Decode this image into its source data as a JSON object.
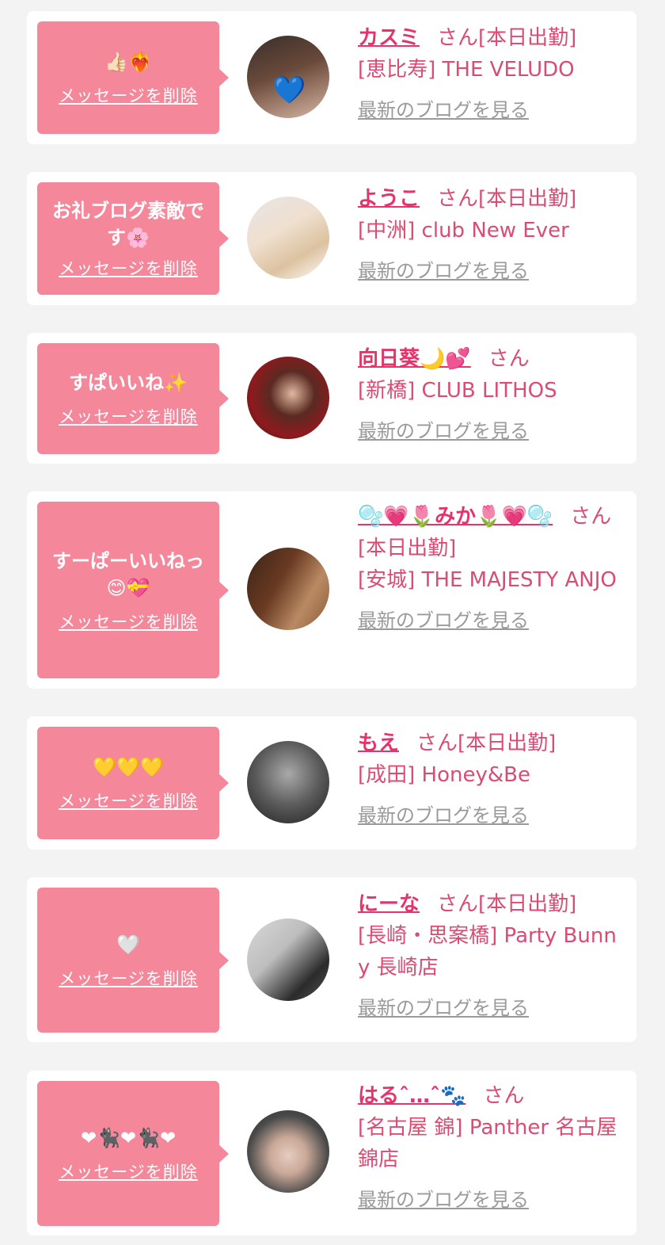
{
  "cards": [
    {
      "message": "👍🏻❤️‍🔥",
      "delete_label": "メッセージを削除",
      "name": "カスミ",
      "honorific": "さん",
      "status": "[本日出勤]",
      "shop": "[恵比寿] THE VELUDO",
      "blog_label": "最新のブログを見る",
      "avatar_colors": [
        "#3a2e2a",
        "#d9b6a6"
      ]
    },
    {
      "message": "お礼ブログ素敵です🌸",
      "delete_label": "メッセージを削除",
      "name": "ようこ",
      "honorific": "さん",
      "status": "[本日出勤]",
      "shop": "[中洲] club New Ever",
      "blog_label": "最新のブログを見る",
      "avatar_colors": [
        "#e8e3e6",
        "#dcc2a0"
      ]
    },
    {
      "message": "すぱいいね✨",
      "delete_label": "メッセージを削除",
      "name": "向日葵🌙💕",
      "honorific": "さん",
      "status": "",
      "shop": "[新橋] CLUB LITHOS",
      "blog_label": "最新のブログを見る",
      "avatar_colors": [
        "#8e1a1e",
        "#2a1a18"
      ]
    },
    {
      "message": "すーぱーいいねっ😊💝",
      "delete_label": "メッセージを削除",
      "name": "🫧💗🌷みか🌷💗🫧",
      "honorific": "さん",
      "status": "[本日出勤]",
      "shop": "[安城] THE MAJESTY ANJO",
      "blog_label": "最新のブログを見る",
      "avatar_colors": [
        "#3b2418",
        "#b98a62"
      ]
    },
    {
      "message": "💛💛💛",
      "delete_label": "メッセージを削除",
      "name": "もえ",
      "honorific": "さん",
      "status": "[本日出勤]",
      "shop": "[成田] Honey&Be",
      "blog_label": "最新のブログを見る",
      "avatar_colors": [
        "#3d3d3d",
        "#a9a9a9"
      ]
    },
    {
      "message": "🤍",
      "delete_label": "メッセージを削除",
      "name": "にーな",
      "honorific": "さん",
      "status": "[本日出勤]",
      "shop": "[長崎・思案橋] Party Bunny 長崎店",
      "blog_label": "最新のブログを見る",
      "avatar_colors": [
        "#d9d9d9",
        "#2b2b2b"
      ]
    },
    {
      "message": "❤🐈‍⬛❤🐈‍⬛❤",
      "delete_label": "メッセージを削除",
      "name": "はるˆ…ˆ🐾",
      "honorific": "さん",
      "status": "",
      "shop": "[名古屋 錦] Panther 名古屋錦店",
      "blog_label": "最新のブログを見る",
      "avatar_colors": [
        "#4a4a4a",
        "#e6cdbf"
      ]
    }
  ]
}
